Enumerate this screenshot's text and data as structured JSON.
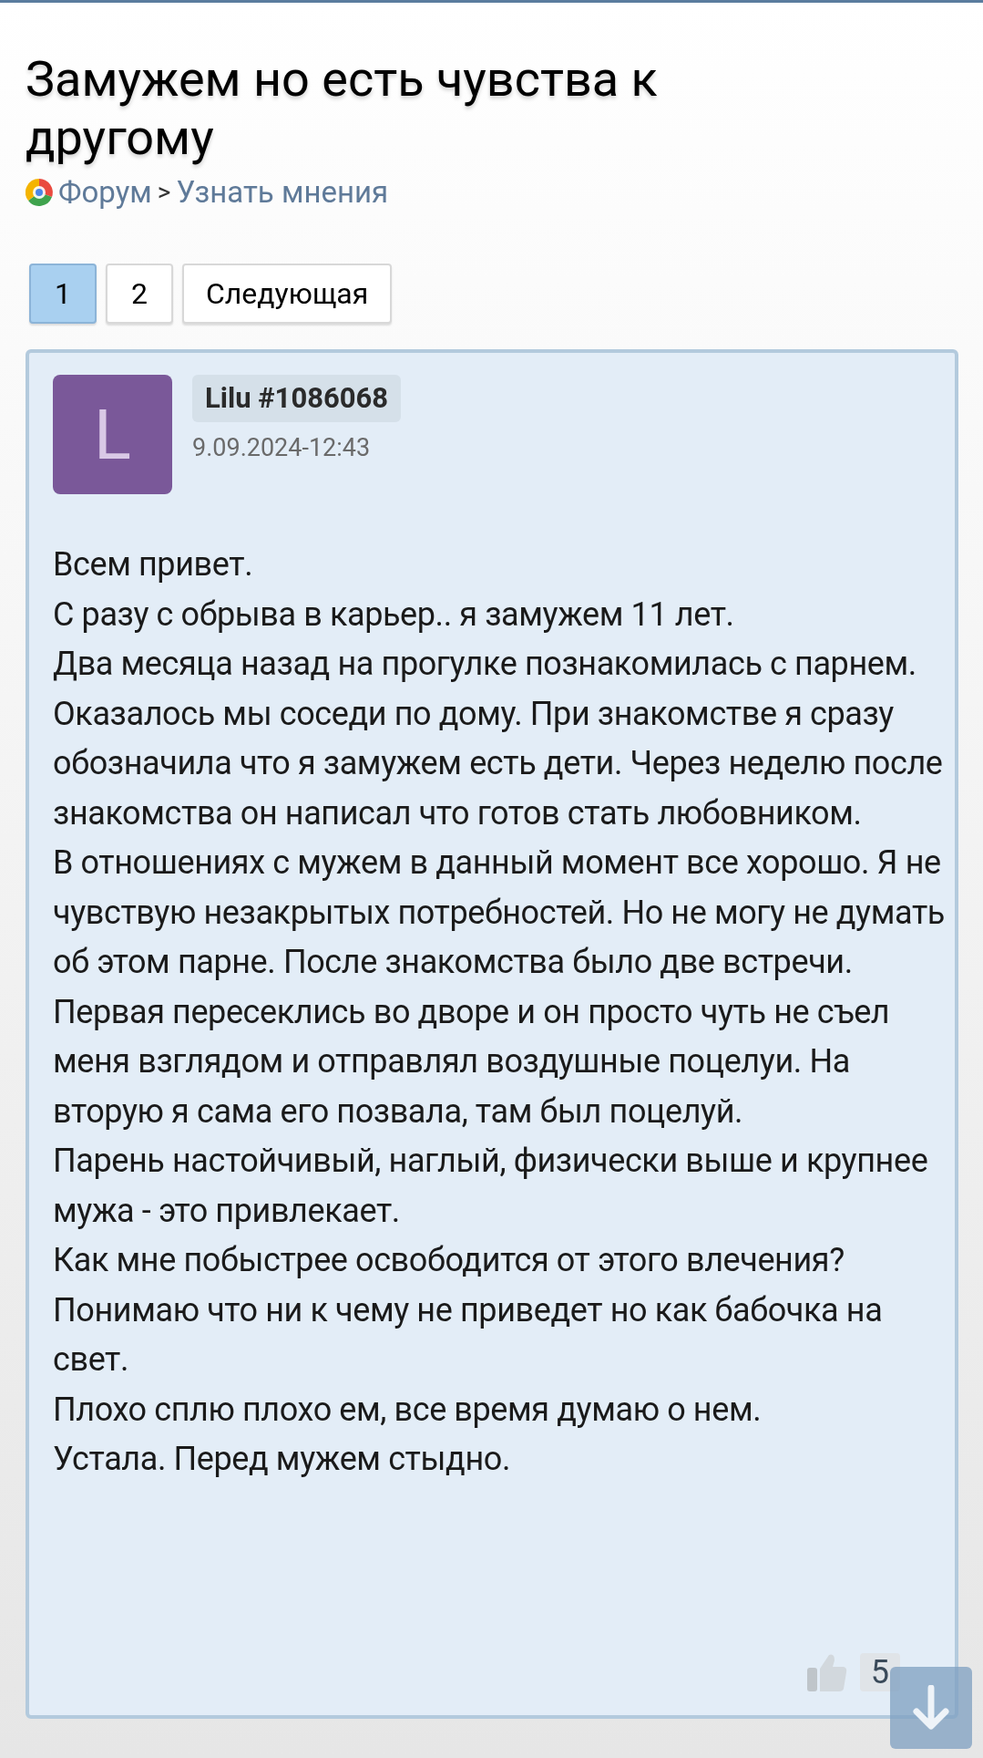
{
  "title": "Замужем но есть чувства к другому",
  "breadcrumb": [
    {
      "label": "Форум"
    },
    {
      "label": "Узнать мнения"
    }
  ],
  "breadcrumb_separator": ">",
  "pagination": [
    {
      "label": "1",
      "selected": true
    },
    {
      "label": "2",
      "selected": false
    },
    {
      "label": "Следующая",
      "selected": false
    }
  ],
  "post": {
    "avatar_letter": "L",
    "author": "Lilu #1086068",
    "date": "9.09.2024-12:43",
    "paragraphs": [
      "Всем привет.",
      "С разу с обрыва в карьер.. я замужем 11 лет.",
      "Два месяца назад на прогулке познакомилась с парнем. Оказалось мы соседи по дому. При знакомстве я сразу обозначила что я замужем есть дети. Через неделю после знакомства он написал что готов стать любовником.",
      "В отношениях с мужем в данный момент все хорошо. Я не чувствую незакрытых потребностей. Но не могу не думать об этом парне. После знакомства было две встречи. Первая пересеклись во дворе и он просто чуть не съел меня взглядом и отправлял воздушные поцелуи. На вторую я сама его позвала, там был поцелуй.",
      "Парень настойчивый, наглый, физически выше и крупнее мужа - это привлекает.",
      "Как мне побыстрее освободится от этого влечения? Понимаю что ни к чему не приведет но как бабочка на свет.",
      "Плохо сплю плохо ем, все время думаю о нем.",
      "Устала. Перед мужем стыдно."
    ],
    "likes": "5"
  }
}
